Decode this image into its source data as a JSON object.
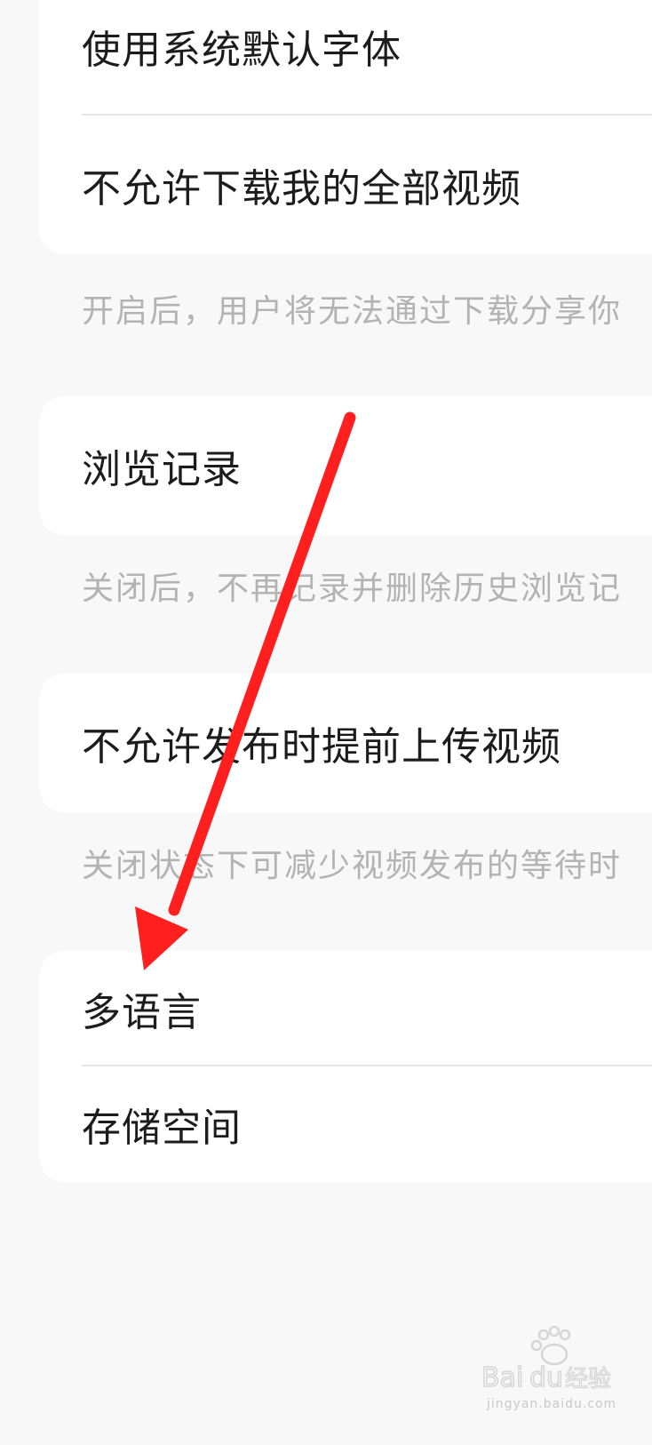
{
  "settings": {
    "group1": {
      "items": [
        {
          "label": "使用系统默认字体"
        },
        {
          "label": "不允许下载我的全部视频"
        }
      ],
      "description": "开启后，用户将无法通过下载分享你"
    },
    "group2": {
      "items": [
        {
          "label": "浏览记录"
        }
      ],
      "description": "关闭后，不再记录并删除历史浏览记"
    },
    "group3": {
      "items": [
        {
          "label": "不允许发布时提前上传视频"
        }
      ],
      "description": "关闭状态下可减少视频发布的等待时"
    },
    "group4": {
      "items": [
        {
          "label": "多语言"
        },
        {
          "label": "存储空间"
        }
      ]
    }
  },
  "annotation": {
    "arrow_color": "#ff1f1f"
  },
  "watermark": {
    "logo_text": "Baidu经验",
    "url_text": "jingyan.baidu.com"
  }
}
